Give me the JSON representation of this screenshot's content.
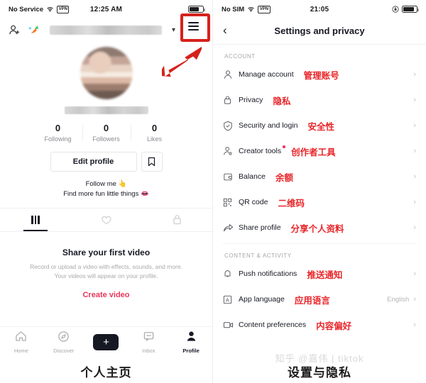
{
  "left": {
    "status": {
      "carrier": "No Service",
      "vpn": "VPN",
      "time": "12:25 AM"
    },
    "header": {
      "add_friend_icon": "add-person-icon",
      "discover_icon": "carrot-icon",
      "chevron": "⌄"
    },
    "stats": [
      {
        "count": "0",
        "label": "Following"
      },
      {
        "count": "0",
        "label": "Followers"
      },
      {
        "count": "0",
        "label": "Likes"
      }
    ],
    "edit_profile_label": "Edit profile",
    "bookmark_icon": "bookmark-icon",
    "bio_line1": "Follow me 👆",
    "bio_line2": "Find more fun little things 👄",
    "tabs": [
      {
        "name": "videos-tab",
        "icon": "grid-bars-icon",
        "active": true
      },
      {
        "name": "liked-tab",
        "icon": "heart-icon",
        "active": false
      },
      {
        "name": "private-tab",
        "icon": "lock-icon",
        "active": false
      }
    ],
    "empty": {
      "title": "Share your first video",
      "desc": "Record or upload a video with effects, sounds, and more. Your videos will appear on your profile.",
      "cta": "Create video"
    },
    "tabbar": [
      {
        "label": "Home",
        "icon": "home-icon"
      },
      {
        "label": "Discover",
        "icon": "compass-icon"
      },
      {
        "label": "+",
        "icon": "create-plus-icon"
      },
      {
        "label": "Inbox",
        "icon": "inbox-icon"
      },
      {
        "label": "Profile",
        "icon": "person-filled-icon"
      }
    ],
    "caption": "个人主页"
  },
  "right": {
    "status": {
      "carrier": "No SIM",
      "vpn": "VPN",
      "time": "21:05"
    },
    "title": "Settings and privacy",
    "back_icon": "chevron-left-icon",
    "sections": [
      {
        "label": "ACCOUNT",
        "rows": [
          {
            "en": "Manage account",
            "cn": "管理账号",
            "icon": "person-icon",
            "value": "",
            "badge": false
          },
          {
            "en": "Privacy",
            "cn": "隐私",
            "icon": "lock-icon",
            "value": "",
            "badge": false
          },
          {
            "en": "Security and login",
            "cn": "安全性",
            "icon": "shield-check-icon",
            "value": "",
            "badge": false
          },
          {
            "en": "Creator tools",
            "cn": "创作者工具",
            "icon": "person-star-icon",
            "value": "",
            "badge": true
          },
          {
            "en": "Balance",
            "cn": "余额",
            "icon": "wallet-icon",
            "value": "",
            "badge": false
          },
          {
            "en": "QR code",
            "cn": "二维码",
            "icon": "qr-code-icon",
            "value": "",
            "badge": false
          },
          {
            "en": "Share profile",
            "cn": "分享个人资料",
            "icon": "share-arrow-icon",
            "value": "",
            "badge": false
          }
        ]
      },
      {
        "label": "CONTENT & ACTIVITY",
        "rows": [
          {
            "en": "Push notifications",
            "cn": "推送通知",
            "icon": "bell-icon",
            "value": "",
            "badge": false
          },
          {
            "en": "App language",
            "cn": "应用语言",
            "icon": "language-a-icon",
            "value": "English",
            "badge": false
          },
          {
            "en": "Content preferences",
            "cn": "内容偏好",
            "icon": "video-camera-icon",
            "value": "",
            "badge": false
          }
        ]
      }
    ],
    "caption": "设置与隐私",
    "watermark": "知乎 @嘉伟 | tiktok"
  },
  "annotation": {
    "highlight_color": "#d6211c",
    "arrow_color": "#d6211c",
    "target": "hamburger-menu-button"
  }
}
